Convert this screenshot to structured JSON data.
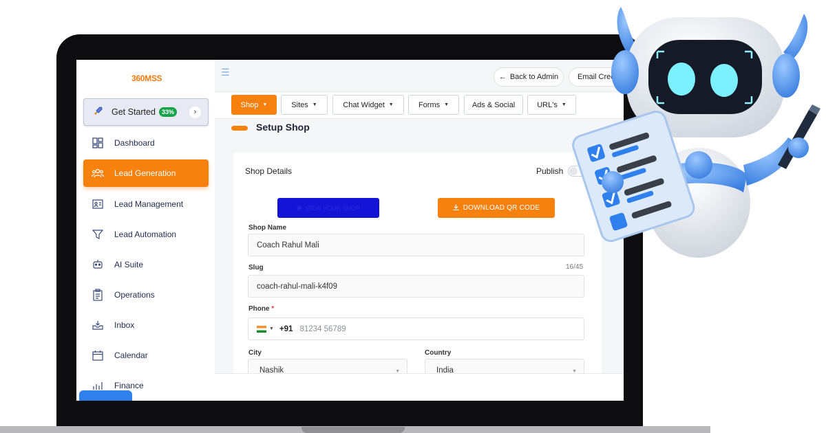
{
  "brand": {
    "logo_text": "360MSS",
    "accent": "#f6810f"
  },
  "sidebar": {
    "get_started": {
      "label": "Get Started",
      "badge": "33%"
    },
    "items": [
      {
        "label": "Dashboard",
        "icon": "dashboard-icon",
        "active": false
      },
      {
        "label": "Lead Generation",
        "icon": "users-icon",
        "active": true
      },
      {
        "label": "Lead Management",
        "icon": "id-card-icon",
        "active": false
      },
      {
        "label": "Lead Automation",
        "icon": "funnel-icon",
        "active": false
      },
      {
        "label": "AI Suite",
        "icon": "robot-icon",
        "active": false
      },
      {
        "label": "Operations",
        "icon": "clipboard-icon",
        "active": false
      },
      {
        "label": "Inbox",
        "icon": "inbox-icon",
        "active": false
      },
      {
        "label": "Calendar",
        "icon": "calendar-icon",
        "active": false
      },
      {
        "label": "Finance",
        "icon": "chart-icon",
        "active": false
      }
    ]
  },
  "header": {
    "back_label": "Back to Admin",
    "email_label": "Email Cred"
  },
  "tabs": [
    {
      "label": "Shop",
      "active": true
    },
    {
      "label": "Sites",
      "active": false
    },
    {
      "label": "Chat Widget",
      "active": false
    },
    {
      "label": "Forms",
      "active": false
    },
    {
      "label": "Ads & Social",
      "active": false
    },
    {
      "label": "URL's",
      "active": false
    }
  ],
  "page": {
    "title": "Setup Shop"
  },
  "form": {
    "section_label": "Shop Details",
    "publish_label": "Publish",
    "view_shop_label": "VIEW YOUR SHOP",
    "qr_label": "DOWNLOAD QR CODE",
    "shop_name": {
      "label": "Shop Name",
      "value": "Coach Rahul Mali"
    },
    "slug": {
      "label": "Slug",
      "value": "coach-rahul-mali-k4f09",
      "count": "16/45"
    },
    "phone": {
      "label": "Phone",
      "required": "*",
      "code": "+91",
      "placeholder": "81234 56789"
    },
    "city": {
      "label": "City",
      "value": "Nashik"
    },
    "country": {
      "label": "Country",
      "value": "India"
    }
  }
}
